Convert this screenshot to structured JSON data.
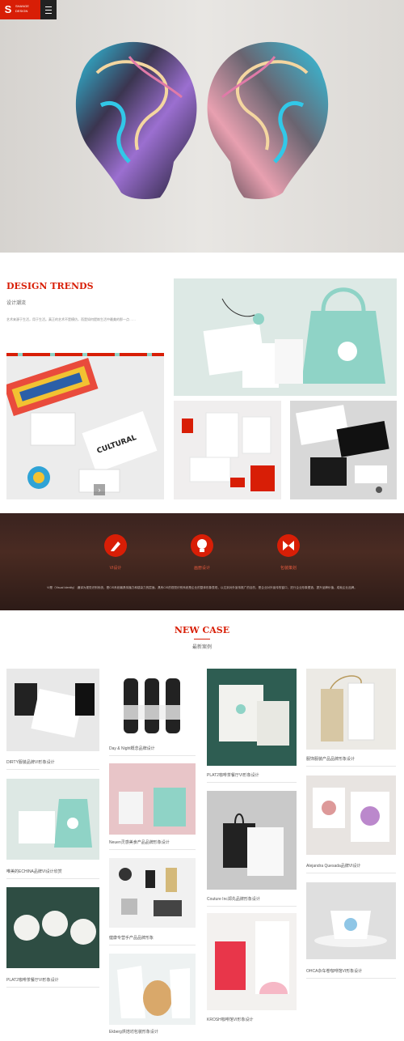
{
  "colors": {
    "accent": "#d81e06",
    "dark_band": "#3a2320",
    "teal": "#8fd3c6"
  },
  "topbar": {
    "logo_mark": "S",
    "logo_text_1": "SHANGE",
    "logo_text_2": "DESIGN",
    "menu_icon": "hamburger-icon"
  },
  "design": {
    "title": "DESIGN TRENDS",
    "subtitle": "设计潮流",
    "body": "艺术来源于生活，用于生活。真正的艺术不是模仿，而是如何提炼生活中最美的那一点……",
    "slider_next_icon": "chevron-right-icon"
  },
  "band": {
    "items": [
      {
        "label": "VI设计",
        "icon": "pencil-icon"
      },
      {
        "label": "画册设计",
        "icon": "bulb-icon"
      },
      {
        "label": "包装策划",
        "icon": "butterfly-icon"
      }
    ],
    "text": "VI是（Visual Identity）.通译为视觉识别系统，是CIS系统最具传播力和感染力的层面。具有CIS的视觉识别系统是企业的整体形象表现，以达到对外宣传推广的目的，是企业对外宣传的窗口，进行企业形象塑造，提升品牌价值，成就企业品牌。"
  },
  "newcase": {
    "title": "NEW CASE",
    "subtitle": "最新案例",
    "captions": {
      "c1": "DIRTY服装品牌VI形象设计",
      "c2": "Day & Night概念品牌设计",
      "c3": "PLAT2咖啡茶餐厅VI形象设计",
      "c4": "服饰服装产品品牌形象设计",
      "c5": "唯美的ECHINA品牌VI设计欣赏",
      "c6": "Neuen灵感美食产品品牌形象设计",
      "c7": "Couture Inc郑先品牌形象设计",
      "c8": "Alejandra Quesada品牌VI设计",
      "c9": "PLAT2咖啡茶餐厅VI形象设计",
      "c10": "健康专营手产品品牌形象",
      "c11": "OHCA杂车卷咖啡馆VI形象设计",
      "c12": "KROSH咖啡馆VI形象设计",
      "c13": "Ekberg烘焙坊包装形象设计"
    }
  }
}
